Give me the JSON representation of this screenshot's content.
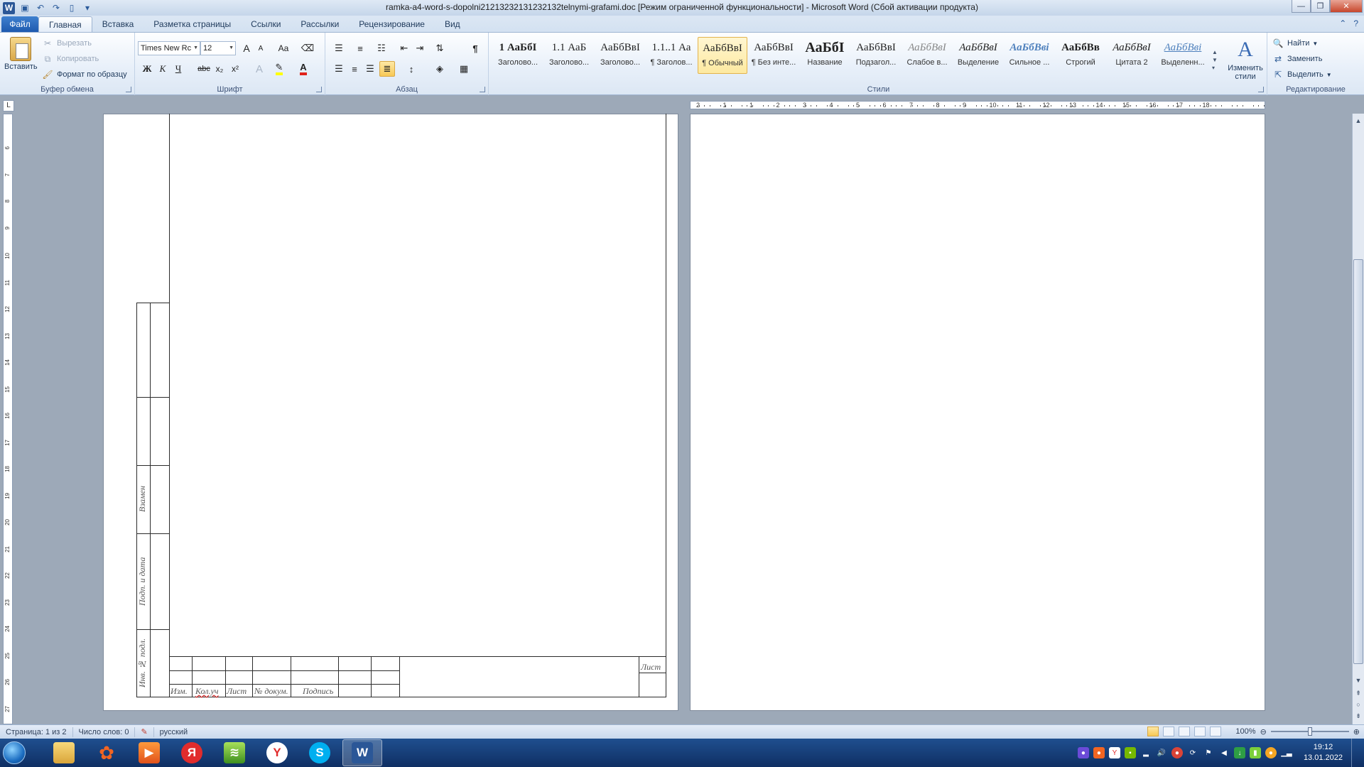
{
  "window": {
    "title": "ramka-a4-word-s-dopolni21213232131232132telnymi-grafami.doc [Режим ограниченной функциональности] - Microsoft Word (Сбой активации продукта)"
  },
  "tabs": {
    "file": "Файл",
    "items": [
      "Главная",
      "Вставка",
      "Разметка страницы",
      "Ссылки",
      "Рассылки",
      "Рецензирование",
      "Вид"
    ]
  },
  "clipboard": {
    "paste": "Вставить",
    "cut": "Вырезать",
    "copy": "Копировать",
    "format_painter": "Формат по образцу",
    "label": "Буфер обмена"
  },
  "font": {
    "name": "Times New Rc",
    "size": "12",
    "label": "Шрифт",
    "bold": "Ж",
    "italic": "К",
    "underline": "Ч",
    "strike": "abc",
    "sub": "x₂",
    "sup": "x²",
    "grow": "A",
    "shrink": "A",
    "case": "Aa"
  },
  "paragraph": {
    "label": "Абзац",
    "pilcrow": "¶"
  },
  "styles": {
    "label": "Стили",
    "items": [
      {
        "preview": "1 АаБбІ",
        "name": "Заголово..."
      },
      {
        "preview": "1.1 АаБ",
        "name": "Заголово..."
      },
      {
        "preview": "АаБбВвI",
        "name": "Заголово..."
      },
      {
        "preview": "1.1..1 Аа",
        "name": "¶ Заголов..."
      },
      {
        "preview": "АаБбВвI",
        "name": "¶ Обычный"
      },
      {
        "preview": "АаБбВвI",
        "name": "¶ Без инте..."
      },
      {
        "preview": "АаБбІ",
        "name": "Название"
      },
      {
        "preview": "АаБбВвІ",
        "name": "Подзагол..."
      },
      {
        "preview": "АаБбВвI",
        "name": "Слабое в..."
      },
      {
        "preview": "АаБбВвI",
        "name": "Выделение"
      },
      {
        "preview": "АаБбВві",
        "name": "Сильное ..."
      },
      {
        "preview": "АаБбВв",
        "name": "Строгий"
      },
      {
        "preview": "АаБбВвI",
        "name": "Цитата 2"
      },
      {
        "preview": "АаБбВві",
        "name": "Выделенн..."
      }
    ],
    "selected_index": 4,
    "change": "Изменить стили"
  },
  "editing": {
    "label": "Редактирование",
    "find": "Найти",
    "replace": "Заменить",
    "select": "Выделить"
  },
  "ruler": {
    "numbers": [
      "2",
      "1",
      "1",
      "2",
      "3",
      "4",
      "5",
      "6",
      "7",
      "8",
      "9",
      "10",
      "11",
      "12",
      "13",
      "14",
      "15",
      "16",
      "17",
      "18"
    ],
    "vnumbers": [
      "6",
      "7",
      "8",
      "9",
      "10",
      "11",
      "12",
      "13",
      "14",
      "15",
      "16",
      "17",
      "18",
      "19",
      "20",
      "21",
      "22",
      "23",
      "24",
      "25",
      "26",
      "27"
    ]
  },
  "frame": {
    "side_labels": [
      "Взамен",
      "Подп. и дата",
      "Инв. № подл."
    ],
    "stamp_headers": [
      "Изм.",
      "Кол.уч",
      "Лист",
      "№ докум.",
      "Подпись"
    ],
    "sheet_label": "Лист"
  },
  "statusbar": {
    "page": "Страница: 1 из 2",
    "words": "Число слов: 0",
    "language": "русский",
    "zoom": "100%"
  },
  "taskbar": {
    "apps": [
      "explorer",
      "media",
      "player",
      "yandex",
      "network",
      "yandex-browser",
      "skype",
      "word"
    ],
    "time": "19:12",
    "date": "13.01.2022"
  },
  "colors": {
    "accent": "#2b5797",
    "ribbon": "#dce7f4",
    "taskbar": "#1f4f8f"
  }
}
